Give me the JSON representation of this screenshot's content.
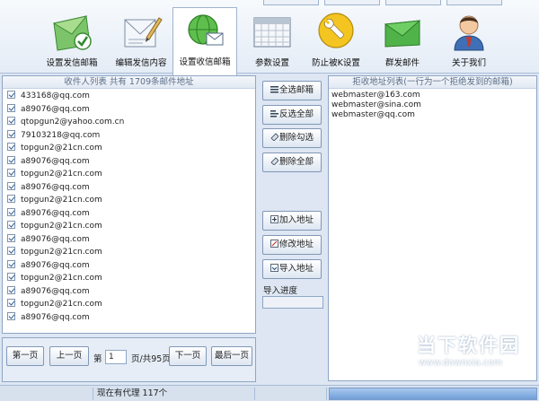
{
  "toolbar": {
    "tools": [
      {
        "label": "设置发信邮箱",
        "icon": "envelope-check-icon"
      },
      {
        "label": "编辑发信内容",
        "icon": "edit-letter-icon"
      },
      {
        "label": "设置收信邮箱",
        "icon": "globe-mail-icon",
        "active": true
      },
      {
        "label": "参数设置",
        "icon": "calendar-grid-icon"
      },
      {
        "label": "防止被K设置",
        "icon": "wrench-icon"
      },
      {
        "label": "群发邮件",
        "icon": "green-envelope-icon"
      },
      {
        "label": "关于我们",
        "icon": "user-icon"
      }
    ]
  },
  "recipients": {
    "title": "收件人列表 共有 1709条邮件地址",
    "emails": [
      "433168@qq.com",
      "a89076@qq.com",
      "qtopgun2@yahoo.com.cn",
      "79103218@qq.com",
      "topgun2@21cn.com",
      "a89076@qq.com",
      "topgun2@21cn.com",
      "a89076@qq.com",
      "topgun2@21cn.com",
      "a89076@qq.com",
      "topgun2@21cn.com",
      "a89076@qq.com",
      "topgun2@21cn.com",
      "a89076@qq.com",
      "topgun2@21cn.com",
      "a89076@qq.com",
      "topgun2@21cn.com",
      "a89076@qq.com"
    ]
  },
  "actions": {
    "select_all": "全选邮箱",
    "invert_select": "反选全部",
    "delete_checked": "删除勾选",
    "delete_all": "删除全部",
    "add_address": "加入地址",
    "edit_address": "修改地址",
    "import_address": "导入地址",
    "import_progress_label": "导入进度",
    "import_progress": 0
  },
  "reject": {
    "title": "拒收地址列表(一行为一个拒绝发到的邮箱)",
    "addresses": [
      "webmaster@163.com",
      "webmaster@sina.com",
      "webmaster@qq.com"
    ]
  },
  "pager": {
    "first": "第一页",
    "prev": "上一页",
    "page_prefix": "第",
    "page_value": "1",
    "page_suffix": "页/共95页",
    "next": "下一页",
    "last": "最后一页"
  },
  "status": {
    "proxy_text": "现在有代理 117个"
  },
  "watermark": {
    "title": "当下软件园",
    "url": "www.downxia.com"
  },
  "colors": {
    "accent": "#6f9ed9",
    "panel_border": "#8ea6c6"
  }
}
